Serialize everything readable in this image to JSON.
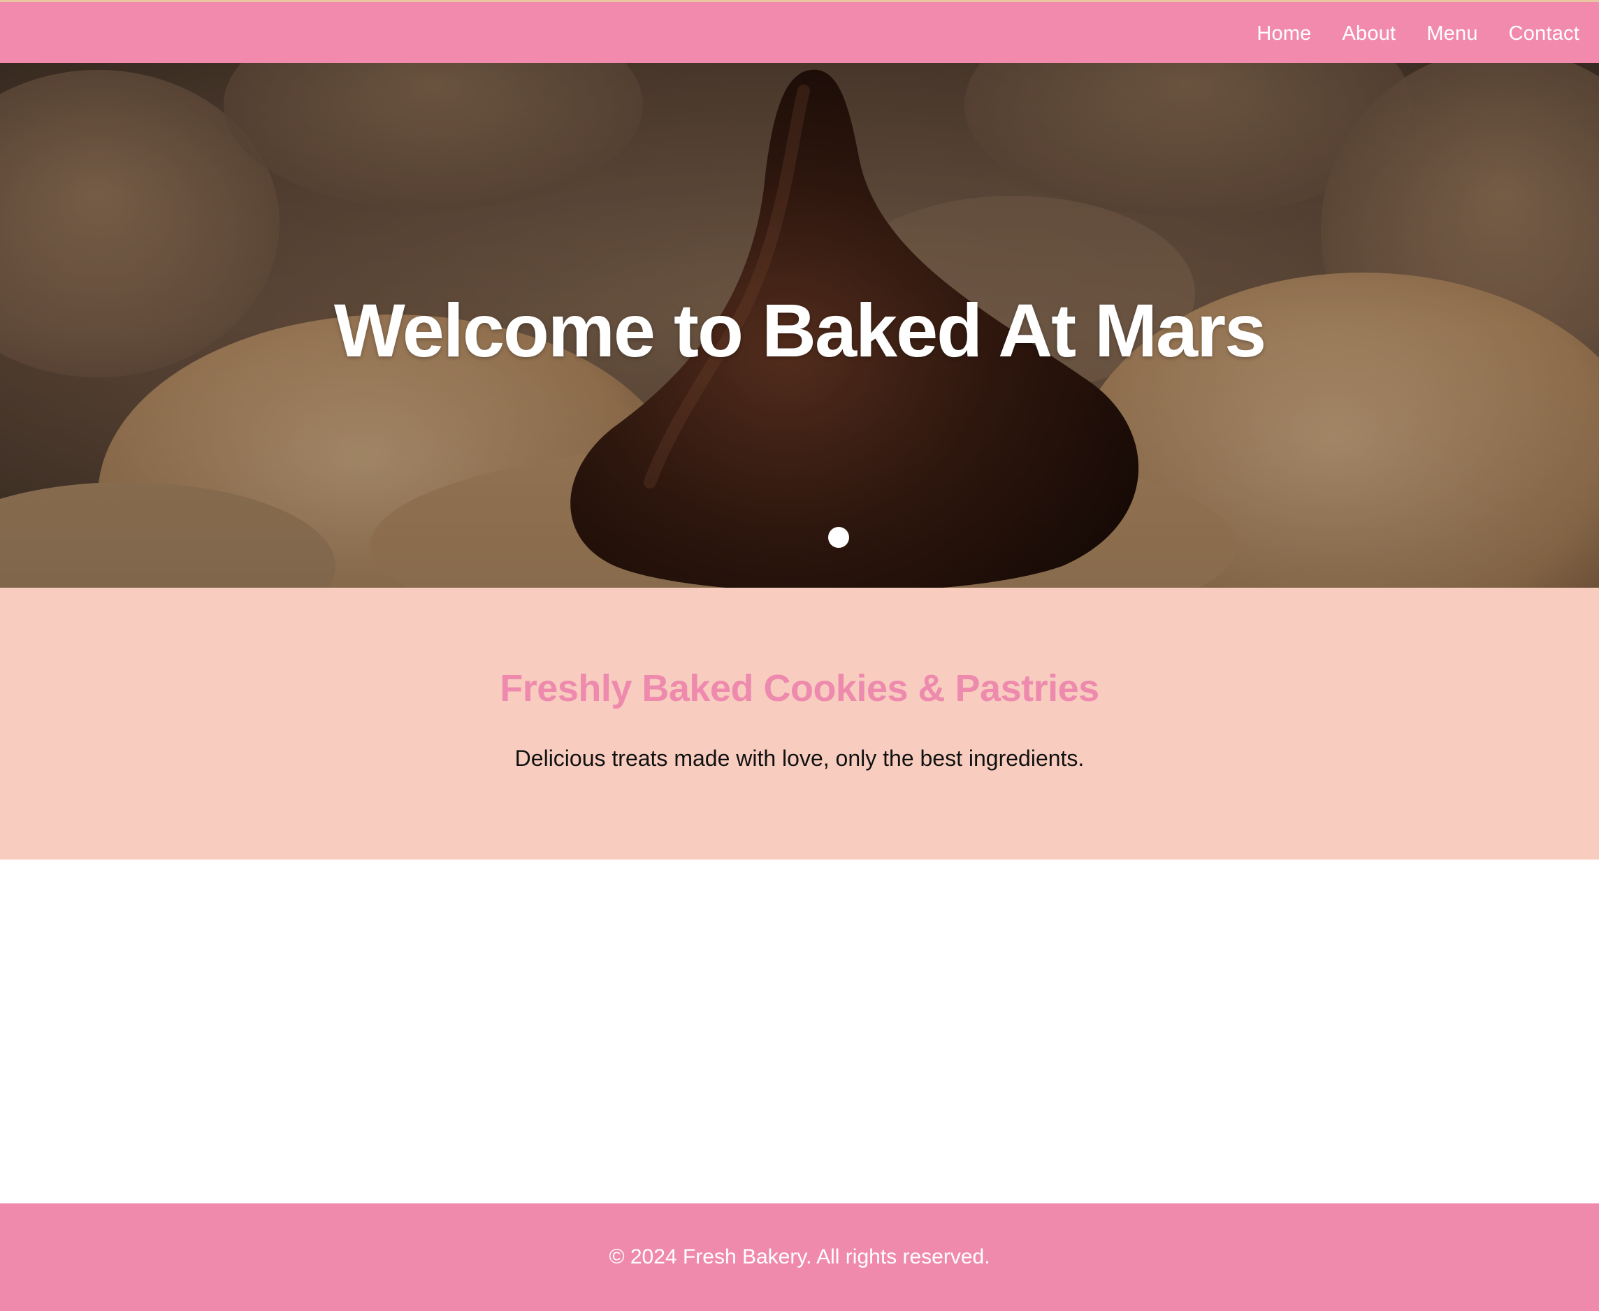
{
  "nav": {
    "items": [
      {
        "label": "Home"
      },
      {
        "label": "About"
      },
      {
        "label": "Menu"
      },
      {
        "label": "Contact"
      }
    ]
  },
  "hero": {
    "title": "Welcome to Baked At Mars",
    "image": "cookie-with-chocolate-kiss-photo",
    "slides": {
      "count": 1,
      "active": 1
    }
  },
  "intro": {
    "heading": "Freshly Baked Cookies & Pastries",
    "text": "Delicious treats made with love, only the best ingredients."
  },
  "footer": {
    "text": "© 2024 Fresh Bakery. All rights reserved."
  },
  "colors": {
    "nav_bg": "#f18aad",
    "accent_pink": "#ee8aae",
    "intro_bg": "#f8cdbf",
    "footer_bg": "#f08aad"
  }
}
